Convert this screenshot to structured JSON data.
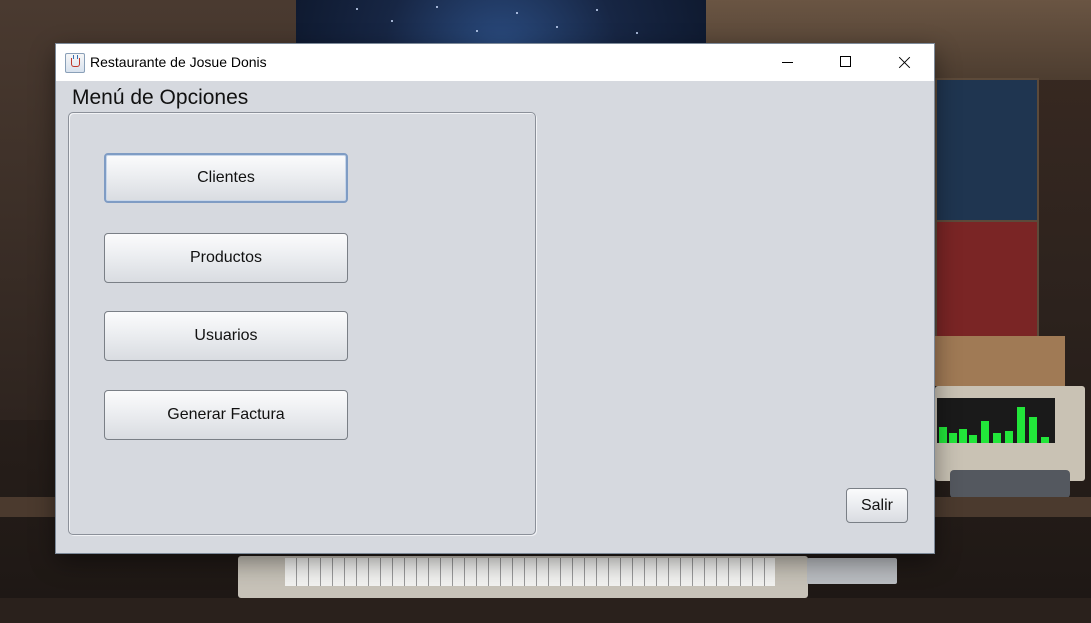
{
  "window": {
    "title": "Restaurante de Josue Donis",
    "controls": {
      "minimize_icon": "minimize-icon",
      "maximize_icon": "maximize-icon",
      "close_icon": "close-icon"
    }
  },
  "menu": {
    "title": "Menú de Opciones",
    "buttons": [
      {
        "label": "Clientes",
        "focused": true
      },
      {
        "label": "Productos",
        "focused": false
      },
      {
        "label": "Usuarios",
        "focused": false
      },
      {
        "label": "Generar Factura",
        "focused": false
      }
    ]
  },
  "footer": {
    "exit_label": "Salir"
  },
  "colors": {
    "window_background": "#d6d9df",
    "titlebar_background": "#ffffff",
    "focus_border": "#7f9cc4"
  }
}
